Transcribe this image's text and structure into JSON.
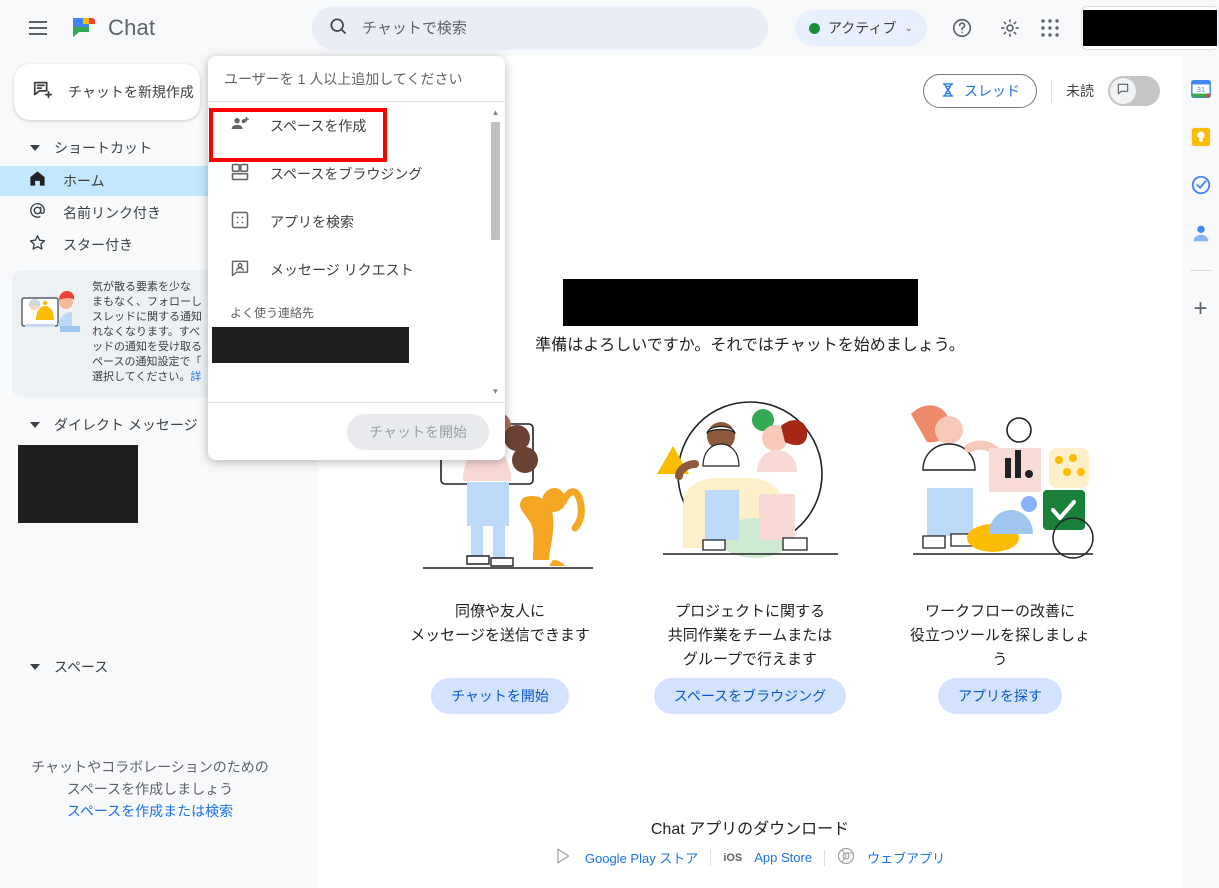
{
  "app": {
    "brand": "Chat",
    "hamburger_icon": "hamburger-menu-icon",
    "logo_icon": "google-chat-logo-icon"
  },
  "search": {
    "placeholder": "チャットで検索",
    "value": "",
    "icon": "search-icon"
  },
  "status": {
    "label": "アクティブ",
    "dot_color": "#1e8e3e",
    "chevron": "⌄"
  },
  "header_icons": [
    {
      "name": "help-icon",
      "glyph": "?"
    },
    {
      "name": "settings-gear-icon",
      "glyph": "gear"
    },
    {
      "name": "google-apps-grid-icon",
      "glyph": "grid"
    }
  ],
  "account": {
    "redacted": true
  },
  "sidebar": {
    "new_chat": {
      "label": "チャットを新規作成",
      "icon": "new-chat-icon"
    },
    "shortcuts_section": {
      "label": "ショートカット"
    },
    "nav_items": [
      {
        "label": "ホーム",
        "icon": "home-icon",
        "active": true
      },
      {
        "label": "名前リンク付き",
        "icon": "mention-at-icon",
        "active": false
      },
      {
        "label": "スター付き",
        "icon": "star-icon",
        "active": false
      }
    ],
    "notice": {
      "illustration": "notification-bell-illustration",
      "lines": [
        "気が散る要素を少な",
        "まもなく、フォローし",
        "スレッドに関する通知",
        "れなくなります。すべ",
        "ッドの通知を受け取る",
        "ペースの通知設定で「",
        "選択してください。"
      ],
      "link_text": "詳"
    },
    "dm_section": {
      "label": "ダイレクト メッセージ"
    },
    "dm_redacted": true,
    "spaces_section": {
      "label": "スペース"
    },
    "spaces_empty": {
      "line1": "チャットやコラボレーションのための",
      "line2": "スペースを作成しましょう",
      "link": "スペースを作成または検索"
    }
  },
  "main": {
    "toolbar": {
      "threads_label": "スレッド",
      "threads_icon": "threads-icon",
      "unread_label": "未読",
      "toggle_icon": "chat-bubble-icon",
      "toggle_on": false
    },
    "welcome_title_redacted": true,
    "welcome_sub": "準備はよろしいですか。それではチャットを始めましょう。",
    "cards": [
      {
        "illustration": "person-with-dog-illustration",
        "text": "同僚や友人に\nメッセージを送信できます",
        "button": "チャットを開始"
      },
      {
        "illustration": "two-people-collaborating-illustration",
        "text": "プロジェクトに関する\n共同作業をチームまたは\nグループで行えます",
        "button": "スペースをブラウジング"
      },
      {
        "illustration": "person-with-tools-illustration",
        "text": "ワークフローの改善に\n役立つツールを探しましょ\nう",
        "button": "アプリを探す"
      }
    ],
    "footer": {
      "title": "Chat アプリのダウンロード",
      "play_store": "Google Play ストア",
      "ios_badge": "iOS",
      "app_store": "App Store",
      "web_app": "ウェブアプリ"
    }
  },
  "dropdown": {
    "input_placeholder": "ユーザーを 1 人以上追加してください",
    "input_value": "",
    "items": [
      {
        "label": "スペースを作成",
        "icon": "create-space-icon",
        "highlighted": true
      },
      {
        "label": "スペースをブラウジング",
        "icon": "browse-spaces-icon",
        "highlighted": false
      },
      {
        "label": "アプリを検索",
        "icon": "find-apps-icon",
        "highlighted": false
      },
      {
        "label": "メッセージ リクエスト",
        "icon": "message-requests-icon",
        "highlighted": false
      }
    ],
    "frequent_contacts_label": "よく使う連絡先",
    "contact_redacted": true,
    "start_button": "チャットを開始",
    "scroll_up_arrow": "▲",
    "scroll_down_arrow": "▼"
  },
  "right_rail": {
    "icons": [
      {
        "name": "google-calendar-icon",
        "label": "31"
      },
      {
        "name": "google-keep-icon",
        "label": ""
      },
      {
        "name": "google-tasks-icon",
        "label": ""
      },
      {
        "name": "google-contacts-icon",
        "label": ""
      }
    ],
    "add_label": "+"
  },
  "colors": {
    "accent_blue": "#1a73e8",
    "active_nav": "#c2e7ff",
    "chip_blue": "#d3e3fd",
    "highlight_red": "#ff0000",
    "page_bg": "#f8f9fa",
    "panel_bg": "#ffffff"
  }
}
